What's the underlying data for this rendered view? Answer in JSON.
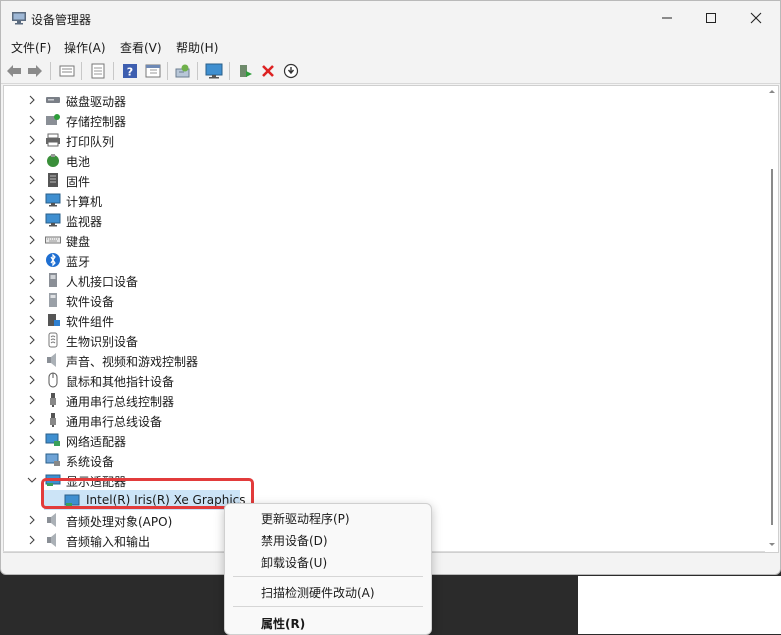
{
  "window": {
    "title": "设备管理器"
  },
  "menu": [
    "文件(F)",
    "操作(A)",
    "查看(V)",
    "帮助(H)"
  ],
  "toolbar_icons": [
    "back-arrow-icon",
    "forward-arrow-icon",
    "properties-icon",
    "window-icon",
    "help-icon",
    "view-icon",
    "scan-hardware-icon",
    "monitor-icon",
    "update-driver-icon",
    "uninstall-x-icon",
    "disable-download-icon"
  ],
  "tree": {
    "categories": [
      {
        "label": "磁盘驱动器",
        "icon": "disk-drive-icon"
      },
      {
        "label": "存储控制器",
        "icon": "storage-controller-icon"
      },
      {
        "label": "打印队列",
        "icon": "printer-icon"
      },
      {
        "label": "电池",
        "icon": "battery-icon"
      },
      {
        "label": "固件",
        "icon": "firmware-icon"
      },
      {
        "label": "计算机",
        "icon": "computer-icon"
      },
      {
        "label": "监视器",
        "icon": "monitor-icon"
      },
      {
        "label": "键盘",
        "icon": "keyboard-icon"
      },
      {
        "label": "蓝牙",
        "icon": "bluetooth-icon"
      },
      {
        "label": "人机接口设备",
        "icon": "hid-icon"
      },
      {
        "label": "软件设备",
        "icon": "software-device-icon"
      },
      {
        "label": "软件组件",
        "icon": "software-component-icon"
      },
      {
        "label": "生物识别设备",
        "icon": "biometric-icon"
      },
      {
        "label": "声音、视频和游戏控制器",
        "icon": "speaker-icon"
      },
      {
        "label": "鼠标和其他指针设备",
        "icon": "mouse-icon"
      },
      {
        "label": "通用串行总线控制器",
        "icon": "usb-icon"
      },
      {
        "label": "通用串行总线设备",
        "icon": "usb-icon"
      },
      {
        "label": "网络适配器",
        "icon": "network-adapter-icon"
      },
      {
        "label": "系统设备",
        "icon": "system-device-icon"
      },
      {
        "label": "显示适配器",
        "icon": "display-adapter-icon"
      },
      {
        "label": "音频处理对象(APO)",
        "icon": "audio-icon"
      },
      {
        "label": "音频输入和输出",
        "icon": "audio-icon"
      }
    ],
    "selected_child": "Intel(R) Iris(R) Xe Graphics"
  },
  "context_menu": {
    "items": [
      "更新驱动程序(P)",
      "禁用设备(D)",
      "卸载设备(U)",
      "扫描检测硬件改动(A)",
      "属性(R)"
    ]
  },
  "colors": {
    "selection": "#cce4f7",
    "highlight_box": "#e23b3b",
    "tree_bg": "#ffffff"
  }
}
